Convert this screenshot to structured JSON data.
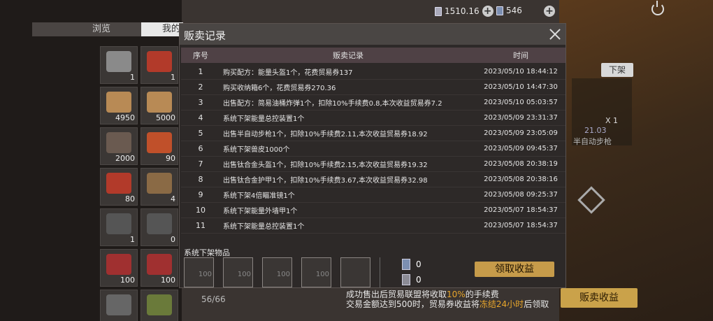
{
  "top_bar": {
    "currency1": "1510.16",
    "currency2": "546",
    "icons": [
      "voucher-icon",
      "plus-icon",
      "coin-icon",
      "plus-icon",
      "power-icon"
    ]
  },
  "bg_tabs": [
    "浏览",
    "我的"
  ],
  "inventory": {
    "items": [
      {
        "count": "1",
        "color": "#8a8a8a"
      },
      {
        "count": "1",
        "color": "#b23a2a"
      },
      {
        "count": "4950",
        "color": "#b88a55"
      },
      {
        "count": "5000",
        "color": "#b88a55"
      },
      {
        "count": "2000",
        "color": "#6a5a50"
      },
      {
        "count": "90",
        "color": "#c0502a"
      },
      {
        "count": "80",
        "color": "#b23a2a"
      },
      {
        "count": "4",
        "color": "#8a6a45"
      },
      {
        "count": "1",
        "color": "#555"
      },
      {
        "count": "0",
        "color": "#555"
      },
      {
        "count": "100",
        "color": "#a03030"
      },
      {
        "count": "100",
        "color": "#a03030"
      },
      {
        "count": "",
        "color": "#666"
      },
      {
        "count": "",
        "color": "#6a7a3a"
      }
    ],
    "capacity": "56/66"
  },
  "right_panel": {
    "unmount_label": "下架",
    "item_qty": "X 1",
    "item_price": "21.03",
    "item_name": "半自动步枪",
    "sell_income_label": "贩卖收益"
  },
  "footer": {
    "line1_a": "成功售出后贸易联盟将收取",
    "line1_b": "10%",
    "line1_c": "的手续费",
    "line2_a": "交易金额达到500时，贸易券收益将",
    "line2_b": "冻结24小时",
    "line2_c": "后领取"
  },
  "dialog": {
    "title": "贩卖记录",
    "columns": {
      "no": "序号",
      "record": "贩卖记录",
      "time": "时间"
    },
    "rows": [
      {
        "no": "1",
        "record": "购买配方：能量头盔1个，花费贸易券137",
        "time": "2023/05/10 18:44:12"
      },
      {
        "no": "2",
        "record": "购买收纳箱6个，花费贸易券270.36",
        "time": "2023/05/10 14:47:30"
      },
      {
        "no": "3",
        "record": "出售配方：简易油桶炸弹1个，扣除10%手续费0.8,本次收益贸易券7.2",
        "time": "2023/05/10 05:03:57"
      },
      {
        "no": "4",
        "record": "系统下架能量总控装置1个",
        "time": "2023/05/09 23:31:37"
      },
      {
        "no": "5",
        "record": "出售半自动步枪1个，扣除10%手续费2.11,本次收益贸易券18.92",
        "time": "2023/05/09 23:05:09"
      },
      {
        "no": "6",
        "record": "系统下架兽皮1000个",
        "time": "2023/05/09 09:45:37"
      },
      {
        "no": "7",
        "record": "出售钛合金头盔1个，扣除10%手续费2.15,本次收益贸易券19.32",
        "time": "2023/05/08 20:38:19"
      },
      {
        "no": "8",
        "record": "出售钛合金护甲1个，扣除10%手续费3.67,本次收益贸易券32.98",
        "time": "2023/05/08 20:38:16"
      },
      {
        "no": "9",
        "record": "系统下架4倍瞄准镜1个",
        "time": "2023/05/08 09:25:37"
      },
      {
        "no": "10",
        "record": "系统下架能量外墙甲1个",
        "time": "2023/05/07 18:54:37"
      },
      {
        "no": "11",
        "record": "系统下架能量总控装置1个",
        "time": "2023/05/07 18:54:37"
      }
    ],
    "system_unmount_label": "系统下架物品",
    "slots": [
      "100",
      "100",
      "100",
      "100",
      ""
    ],
    "voucher_a": "0",
    "voucher_b": "0",
    "claim_label": "领取收益"
  }
}
